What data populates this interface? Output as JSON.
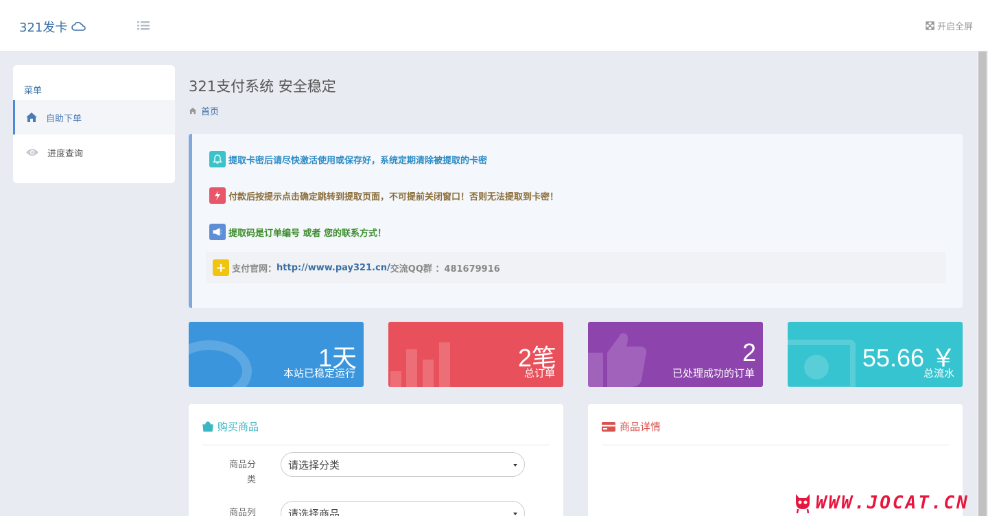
{
  "header": {
    "brand": "321发卡",
    "brand_icon": "cloud-icon",
    "menu_icon": "list-icon",
    "fullscreen_label": "开启全屏",
    "fullscreen_icon": "expand-icon"
  },
  "sidebar": {
    "title": "菜单",
    "items": [
      {
        "label": "自助下单",
        "icon": "home-icon",
        "active": true
      },
      {
        "label": "进度查询",
        "icon": "eye-icon",
        "active": false
      }
    ]
  },
  "page": {
    "title": "321支付系统 安全稳定",
    "breadcrumb": "首页"
  },
  "notices": [
    {
      "text": "提取卡密后请尽快激活使用或保存好，系统定期清除被提取的卡密",
      "icon": "bell-icon",
      "icon_color": "#3bc3c9",
      "text_color": "#2b8bc4"
    },
    {
      "text": "付款后按提示点击确定跳转到提取页面，不可提前关闭窗口！否则无法提取到卡密！",
      "icon": "bolt-icon",
      "icon_color": "#e8566a",
      "text_color": "#8a6d3b"
    },
    {
      "text": "提取码是订单编号 或者 您的联系方式！",
      "icon": "megaphone-icon",
      "icon_color": "#5e8fd6",
      "text_color": "#3c8c2c"
    }
  ],
  "notice_footer": {
    "icon": "plus-icon",
    "icon_color": "#f1c40f",
    "prefix": "支付官网：",
    "url": "http://www.pay321.cn/",
    "suffix": " 交流QQ群 ：481679916"
  },
  "stats": [
    {
      "value": "1天",
      "label": "本站已稳定运行",
      "color": "#3a95dc",
      "icon": "speedometer-icon"
    },
    {
      "value": "2笔",
      "label": "总订单",
      "color": "#e8505b",
      "icon": "bar-chart-icon"
    },
    {
      "value": "2",
      "label": "已处理成功的订单",
      "color": "#8e44ad",
      "icon": "thumbs-up-icon"
    },
    {
      "value": "55.66 ￥",
      "label": "总流水",
      "color": "#35c4d0",
      "icon": "money-icon"
    }
  ],
  "buy_panel": {
    "title": "购买商品",
    "title_color": "#3bb6c4",
    "category_label": "商品分类",
    "category_placeholder": "请选择分类",
    "product_label": "商品列表",
    "product_placeholder": "请选择商品"
  },
  "detail_panel": {
    "title": "商品详情",
    "title_color": "#d9534f"
  },
  "watermark": "WWW.JOCAT.CN"
}
